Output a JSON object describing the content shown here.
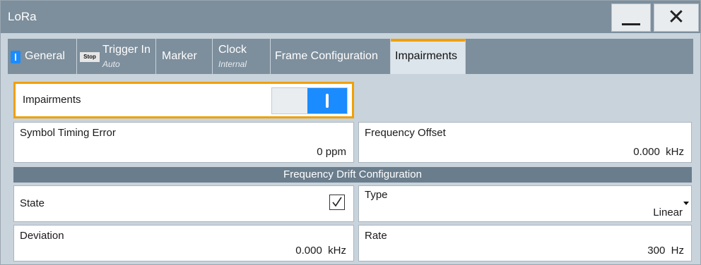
{
  "window": {
    "title": "LoRa"
  },
  "tabs": [
    {
      "label": "General"
    },
    {
      "label": "Trigger In",
      "sub": "Auto",
      "badge": "Stop"
    },
    {
      "label": "Marker"
    },
    {
      "label": "Clock",
      "sub": "Internal"
    },
    {
      "label": "Frame Configuration"
    },
    {
      "label": "Impairments"
    }
  ],
  "impairments": {
    "label": "Impairments",
    "state": "on"
  },
  "symbol_timing_error": {
    "label": "Symbol Timing Error",
    "value": "0 ppm"
  },
  "frequency_offset": {
    "label": "Frequency Offset",
    "value": "0.000  kHz"
  },
  "drift": {
    "header": "Frequency Drift Configuration",
    "state": {
      "label": "State",
      "checked": true
    },
    "type": {
      "label": "Type",
      "value": "Linear"
    },
    "deviation": {
      "label": "Deviation",
      "value": "0.000  kHz"
    },
    "rate": {
      "label": "Rate",
      "value": "300  Hz"
    }
  },
  "colors": {
    "accent": "#f0a000",
    "toggle_on": "#1a8cff",
    "titlebar": "#7d8e9c"
  }
}
